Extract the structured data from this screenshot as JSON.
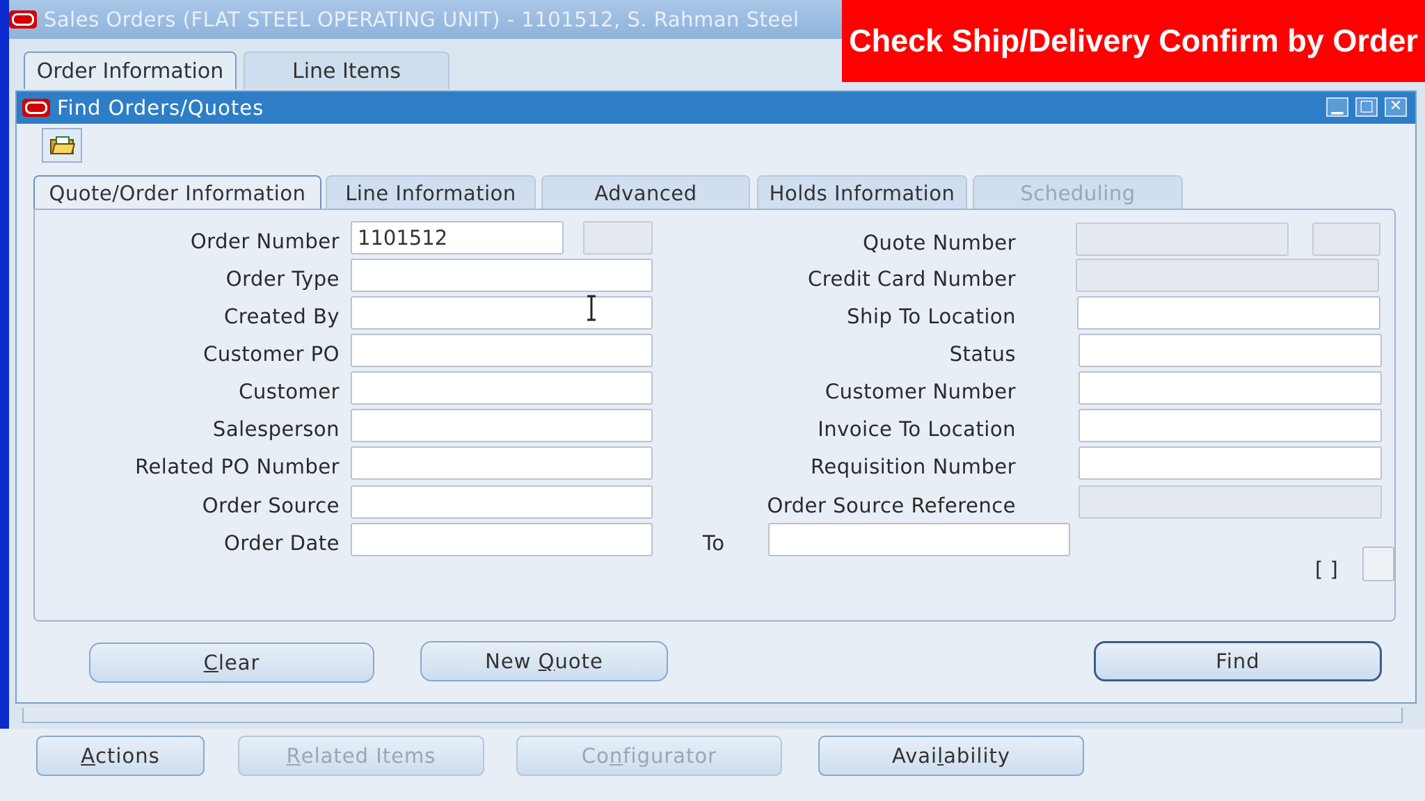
{
  "window": {
    "title": "Sales Orders (FLAT STEEL OPERATING UNIT) - 1101512, S. Rahman Steel"
  },
  "banner": {
    "text": "Check Ship/Delivery Confirm by Order"
  },
  "main_tabs": [
    {
      "label": "Order Information",
      "active": true
    },
    {
      "label": "Line Items",
      "active": false
    }
  ],
  "find_dialog": {
    "title": "Find  Orders/Quotes",
    "tabs": [
      {
        "label": "Quote/Order Information",
        "active": true
      },
      {
        "label": "Line Information"
      },
      {
        "label": "Advanced"
      },
      {
        "label": "Holds Information"
      },
      {
        "label": "Scheduling",
        "disabled": true
      }
    ],
    "left_fields": {
      "order_number": {
        "label": "Order Number",
        "value": "1101512"
      },
      "order_type": {
        "label": "Order Type",
        "value": ""
      },
      "created_by": {
        "label": "Created By",
        "value": ""
      },
      "customer_po": {
        "label": "Customer PO",
        "value": ""
      },
      "customer": {
        "label": "Customer",
        "value": ""
      },
      "salesperson": {
        "label": "Salesperson",
        "value": ""
      },
      "related_po_number": {
        "label": "Related PO Number",
        "value": ""
      },
      "order_source": {
        "label": "Order Source",
        "value": ""
      },
      "order_date": {
        "label": "Order Date",
        "value": ""
      }
    },
    "to_label": "To",
    "right_fields": {
      "quote_number": {
        "label": "Quote Number",
        "value": ""
      },
      "credit_card_number": {
        "label": "Credit Card Number",
        "value": ""
      },
      "ship_to_location": {
        "label": "Ship To Location",
        "value": ""
      },
      "status": {
        "label": "Status",
        "value": ""
      },
      "customer_number": {
        "label": "Customer Number",
        "value": ""
      },
      "invoice_to_location": {
        "label": "Invoice To Location",
        "value": ""
      },
      "requisition_number": {
        "label": "Requisition Number",
        "value": ""
      },
      "order_source_reference": {
        "label": "Order Source Reference",
        "value": ""
      }
    },
    "dff_label": "[ ]",
    "buttons": {
      "clear": {
        "pre": "",
        "key": "C",
        "post": "lear"
      },
      "new_quote": {
        "pre": "New ",
        "key": "Q",
        "post": "uote"
      },
      "find": "Find"
    }
  },
  "bottom_buttons": {
    "actions": {
      "pre": "",
      "key": "A",
      "post": "ctions"
    },
    "related_items": {
      "pre": "",
      "key": "R",
      "post": "elated Items"
    },
    "configurator": {
      "pre": "Co",
      "key": "n",
      "post": "figurator"
    },
    "availability": {
      "pre": "Avai",
      "key": "l",
      "post": "ability"
    }
  },
  "colors": {
    "banner": "#ff0000",
    "find_titlebar": "#2d7ec7",
    "main_titlebar": "#a9c7e8",
    "oracle_logo": "#d20000"
  }
}
